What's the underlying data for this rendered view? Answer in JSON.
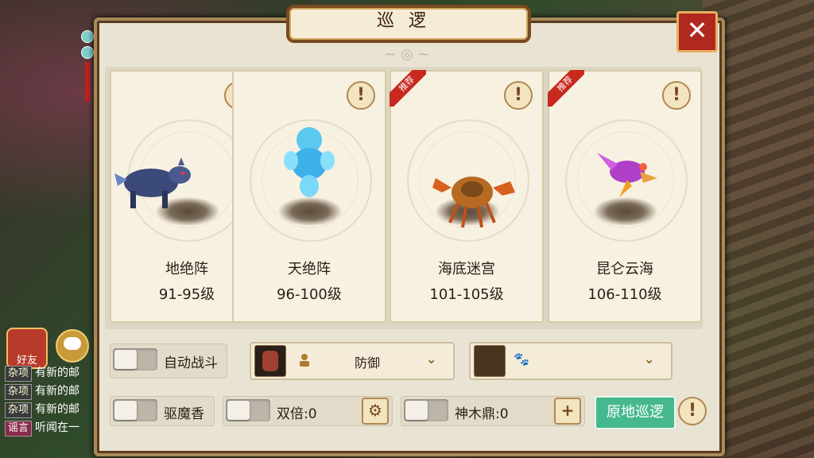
{
  "window": {
    "title": "巡逻",
    "close_label": "✕"
  },
  "cards": [
    {
      "name": "地绝阵",
      "level": "91-95级",
      "recommended": false,
      "creature": "wolf-icon"
    },
    {
      "name": "天绝阵",
      "level": "96-100级",
      "recommended": false,
      "creature": "ice-spirit-icon"
    },
    {
      "name": "海底迷宫",
      "level": "101-105级",
      "recommended": true,
      "creature": "crab-icon"
    },
    {
      "name": "昆仑云海",
      "level": "106-110级",
      "recommended": true,
      "creature": "phoenix-icon"
    }
  ],
  "ribbon_label": "推荐",
  "info_label": "!",
  "controls": {
    "auto_battle": "自动战斗",
    "repel": "驱魔香",
    "double": "双倍:0",
    "divine_cauldron": "神木鼎:0",
    "stance_dropdown": "防御",
    "patrol_here": "原地巡逻",
    "plus": "+",
    "gear": "⚙",
    "paw": "🐾"
  },
  "chat": {
    "friend_label": "好友",
    "lines": [
      {
        "tag": "杂项",
        "text": "有新的邮"
      },
      {
        "tag": "杂项",
        "text": "有新的邮"
      },
      {
        "tag": "杂项",
        "text": "有新的邮"
      },
      {
        "tag": "谣言",
        "text": "听闻在一"
      }
    ]
  },
  "colors": {
    "accent_green": "#46b88e",
    "close_red": "#b0281e",
    "panel_bg": "#e9e3d3"
  }
}
